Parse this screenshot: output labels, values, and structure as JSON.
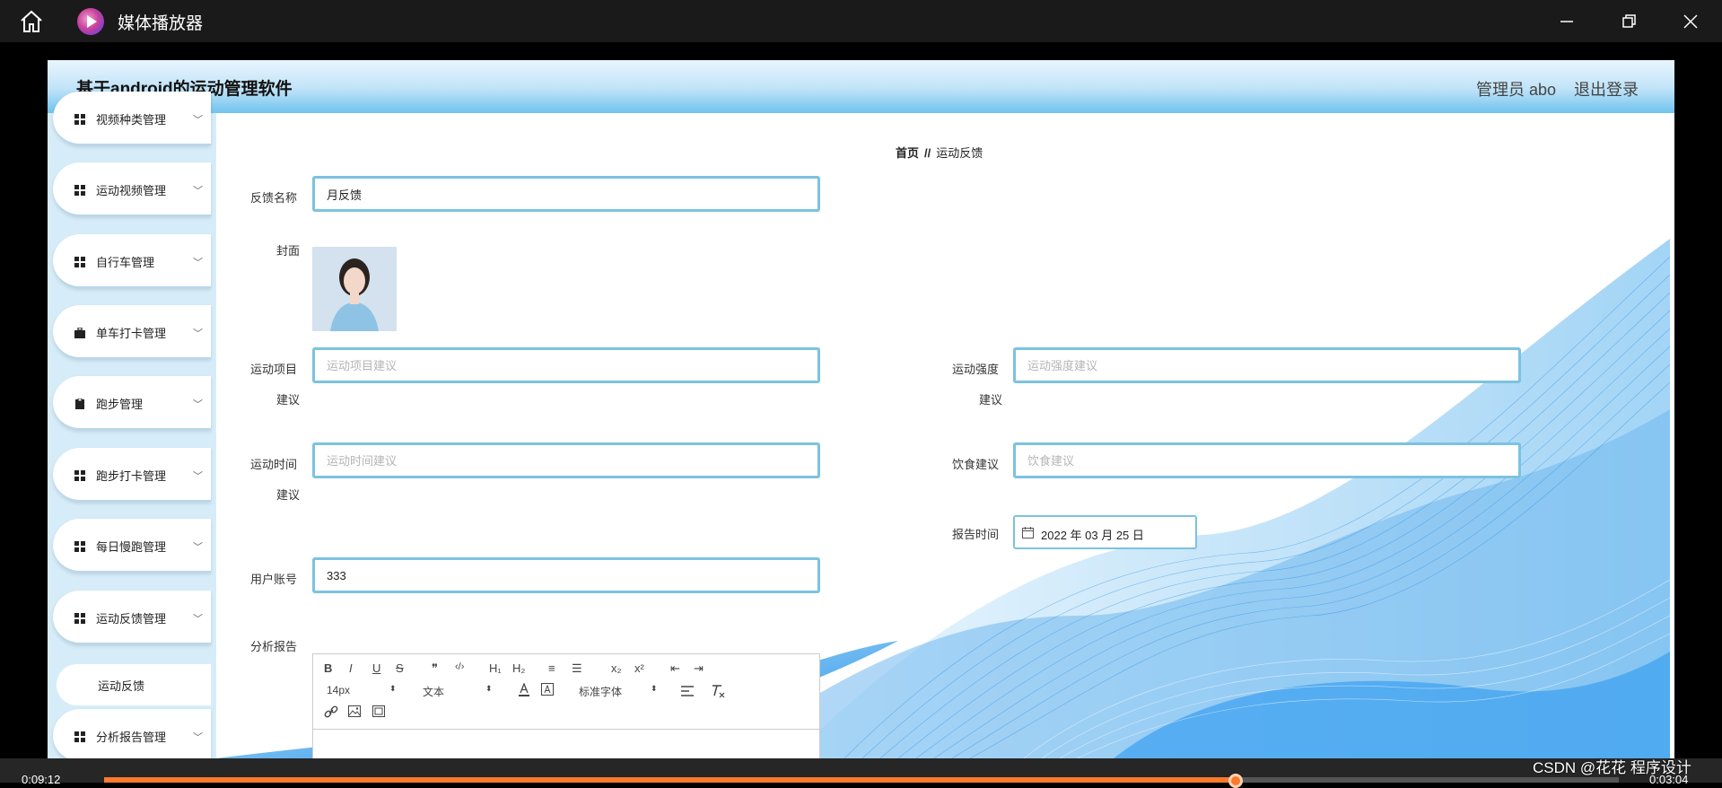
{
  "player": {
    "title": "媒体播放器",
    "time_current": "0:09:12",
    "time_total": "0:03:04",
    "progress_fraction": 0.747,
    "accent": "#ff7a2b",
    "watermark": "CSDN @花花 程序设计"
  },
  "app": {
    "site_title": "基于android的运动管理软件",
    "admin_label": "管理员 abo",
    "logout_label": "退出登录"
  },
  "sidebar": {
    "items": [
      {
        "label": "视频种类管理",
        "icon": "grid-icon"
      },
      {
        "label": "运动视频管理",
        "icon": "grid-icon"
      },
      {
        "label": "自行车管理",
        "icon": "grid-icon"
      },
      {
        "label": "单车打卡管理",
        "icon": "briefcase-icon"
      },
      {
        "label": "跑步管理",
        "icon": "clipboard-icon"
      },
      {
        "label": "跑步打卡管理",
        "icon": "grid-icon"
      },
      {
        "label": "每日慢跑管理",
        "icon": "grid-icon"
      },
      {
        "label": "运动反馈管理",
        "icon": "grid-icon"
      },
      {
        "label": "分析报告管理",
        "icon": "grid-icon"
      }
    ],
    "submenu": {
      "label": "运动反馈"
    }
  },
  "breadcrumb": {
    "home": "首页",
    "separator": "//",
    "current": "运动反馈"
  },
  "form": {
    "feedback_name": {
      "label": "反馈名称",
      "value": "月反馈"
    },
    "cover": {
      "label": "封面"
    },
    "sport_item": {
      "label_line1": "运动项目",
      "label_line2": "建议",
      "placeholder": "运动项目建议"
    },
    "sport_intensity": {
      "label_line1": "运动强度",
      "label_line2": "建议",
      "placeholder": "运动强度建议"
    },
    "sport_time": {
      "label_line1": "运动时间",
      "label_line2": "建议",
      "placeholder": "运动时间建议"
    },
    "diet": {
      "label": "饮食建议",
      "placeholder": "饮食建议"
    },
    "report_time": {
      "label": "报告时间",
      "value": "2022 年 03 月 25 日"
    },
    "user_account": {
      "label": "用户账号",
      "value": "333"
    },
    "analysis_report": {
      "label": "分析报告"
    }
  },
  "editor": {
    "toolbar_row1": [
      "B",
      "I",
      "U",
      "S",
      "❞",
      "‹/›",
      "H₁",
      "H₂",
      "≡",
      "☰",
      "x₂",
      "x²",
      "⇤",
      "⇥"
    ],
    "size_select": "14px",
    "format_select": "文本",
    "font_select": "标准字体"
  }
}
